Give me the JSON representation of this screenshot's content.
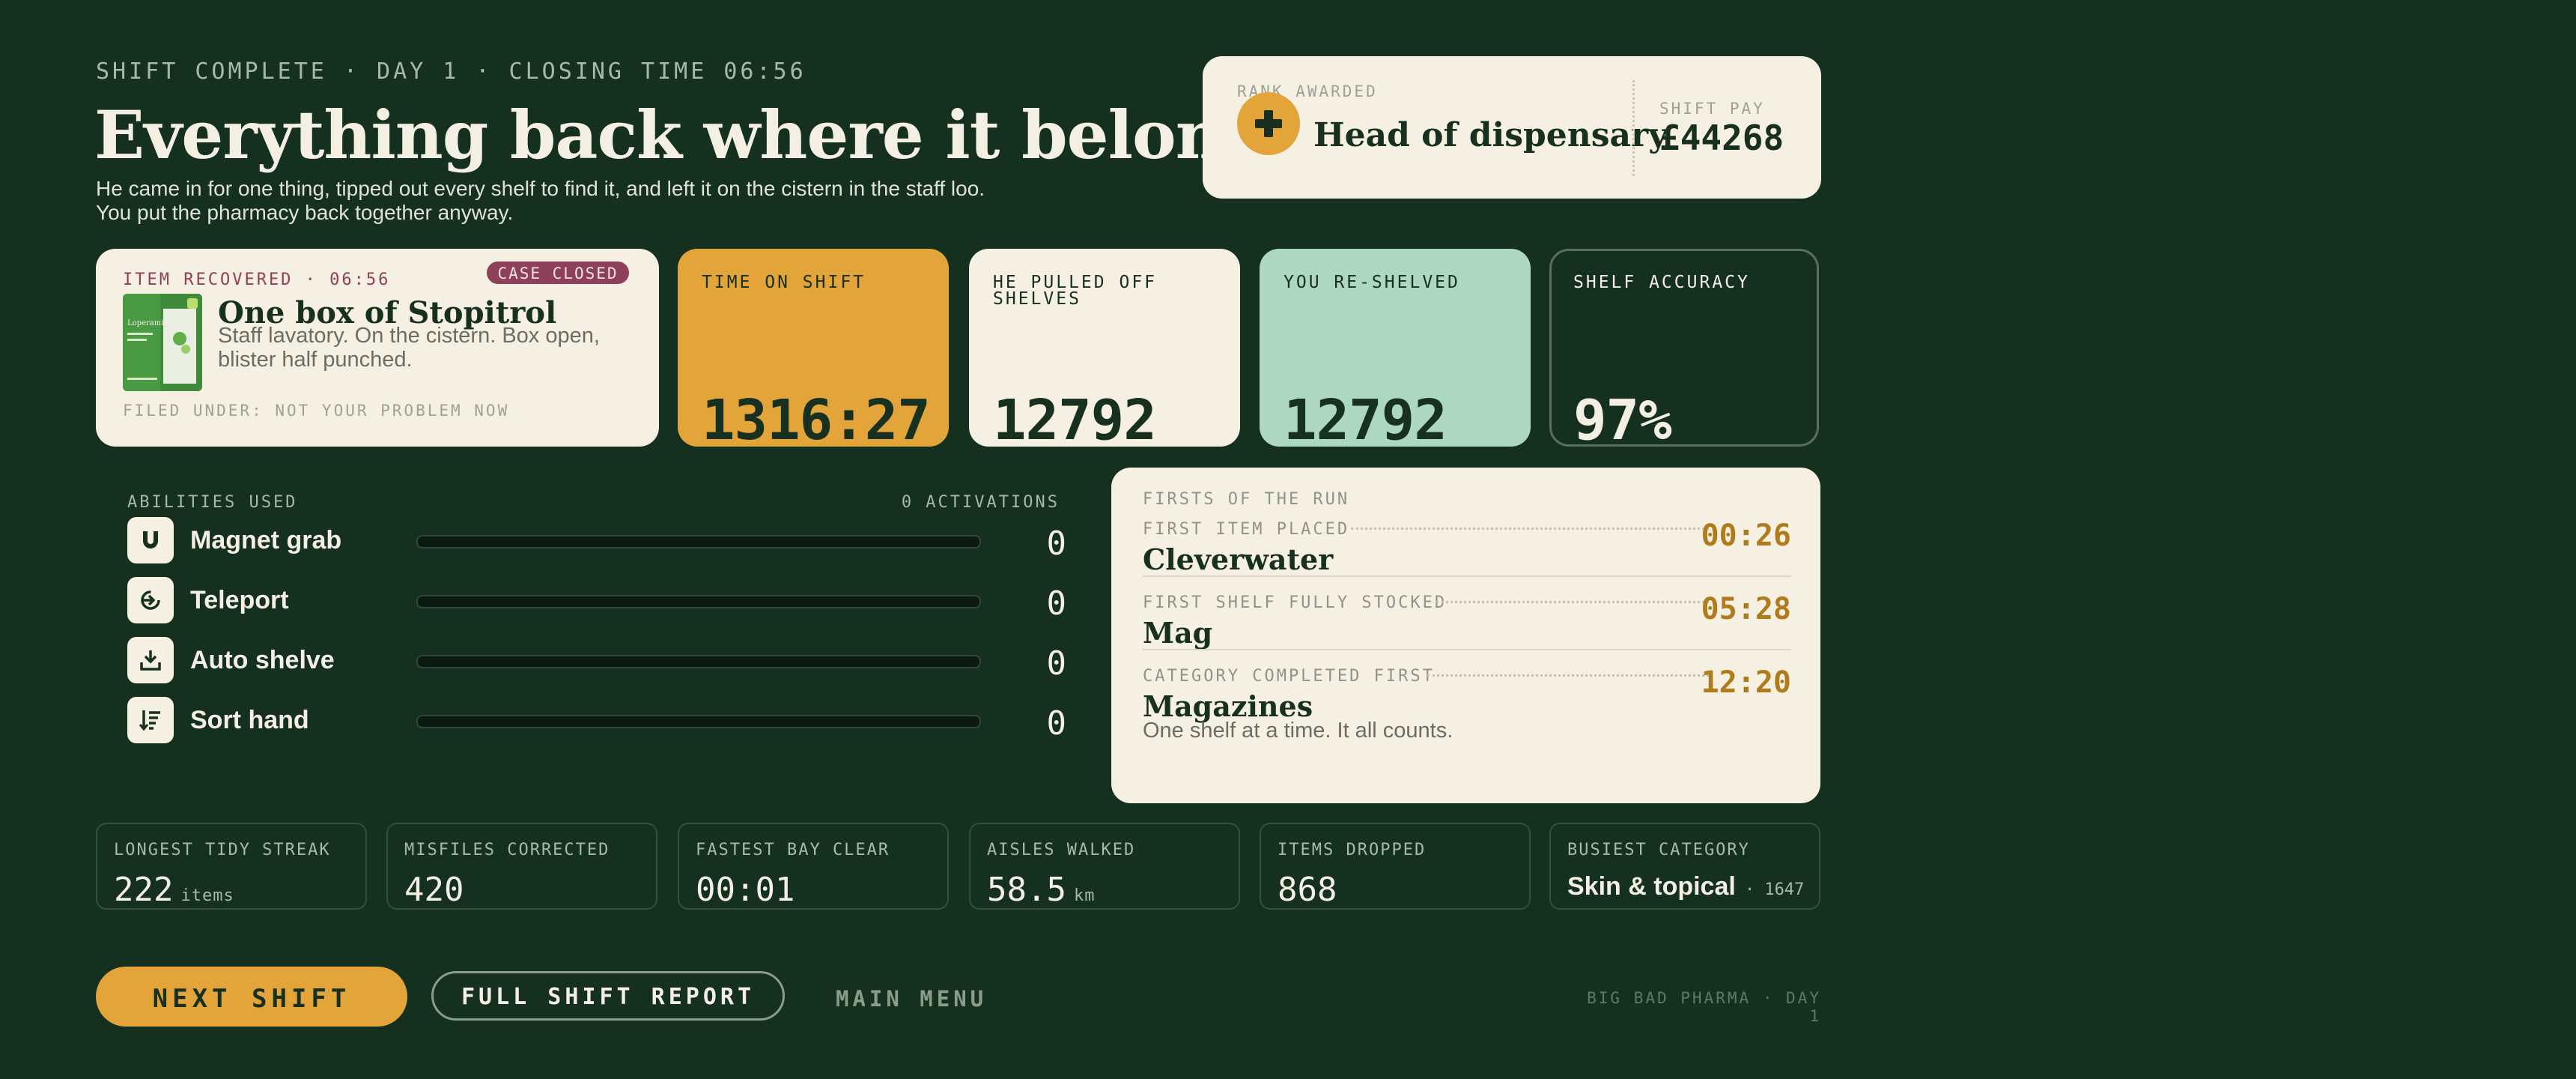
{
  "header": {
    "eyebrow": "SHIFT COMPLETE · DAY 1 · CLOSING TIME 06:56",
    "title": "Everything back where it belongs.",
    "subtitle": "He came in for one thing, tipped out every shelf to find it, and left it on the cistern in the staff loo. You put the pharmacy back together anyway."
  },
  "rank": {
    "label": "RANK AWARDED",
    "title": "Head of dispensary",
    "icon": "plus-icon",
    "pay_label": "SHIFT PAY",
    "pay_value": "£44268"
  },
  "item": {
    "label": "ITEM RECOVERED · 06:56",
    "badge": "CASE CLOSED",
    "name": "One box of Stopitrol",
    "description": "Staff lavatory. On the cistern. Box open, blister half punched.",
    "filed": "FILED UNDER: NOT YOUR PROBLEM NOW",
    "package_text": "Loperamide"
  },
  "stats": {
    "time_label": "TIME ON SHIFT",
    "time_value": "1316:27",
    "pulled_label": "HE PULLED OFF SHELVES",
    "pulled_value": "12792",
    "reshelved_label": "YOU RE-SHELVED",
    "reshelved_value": "12792",
    "accuracy_label": "SHELF ACCURACY",
    "accuracy_value": "97%"
  },
  "abilities": {
    "label": "ABILITIES USED",
    "count": "0 ACTIVATIONS",
    "items": [
      {
        "name": "Magnet grab",
        "icon": "magnet-icon",
        "value": "0",
        "fill": 0
      },
      {
        "name": "Teleport",
        "icon": "teleport-icon",
        "value": "0",
        "fill": 0
      },
      {
        "name": "Auto shelve",
        "icon": "download-tray-icon",
        "value": "0",
        "fill": 0
      },
      {
        "name": "Sort hand",
        "icon": "sort-icon",
        "value": "0",
        "fill": 0
      }
    ]
  },
  "firsts": {
    "label": "FIRSTS OF THE RUN",
    "items": [
      {
        "category": "FIRST ITEM PLACED",
        "time": "00:26",
        "name": "Cleverwater"
      },
      {
        "category": "FIRST SHELF FULLY STOCKED",
        "time": "05:28",
        "name": "Mag"
      },
      {
        "category": "CATEGORY COMPLETED FIRST",
        "time": "12:20",
        "name": "Magazines"
      }
    ],
    "footer": "One shelf at a time. It all counts."
  },
  "bottom_stats": [
    {
      "label": "LONGEST TIDY STREAK",
      "value": "222",
      "unit": "items"
    },
    {
      "label": "MISFILES CORRECTED",
      "value": "420",
      "unit": ""
    },
    {
      "label": "FASTEST BAY CLEAR",
      "value": "00:01",
      "unit": ""
    },
    {
      "label": "AISLES WALKED",
      "value": "58.5",
      "unit": "km"
    },
    {
      "label": "ITEMS DROPPED",
      "value": "868",
      "unit": ""
    },
    {
      "label": "BUSIEST CATEGORY",
      "value": "Skin & topical",
      "unit": "· 1647"
    }
  ],
  "footer": {
    "next": "NEXT SHIFT",
    "report": "FULL SHIFT REPORT",
    "menu": "MAIN MENU",
    "brand": "BIG BAD PHARMA · DAY 1"
  },
  "colors": {
    "background": "#16301f",
    "accent": "#e3a43a",
    "cream": "#f5f0e1",
    "mint": "#acd8bf",
    "case_badge": "#8e3f5a"
  }
}
